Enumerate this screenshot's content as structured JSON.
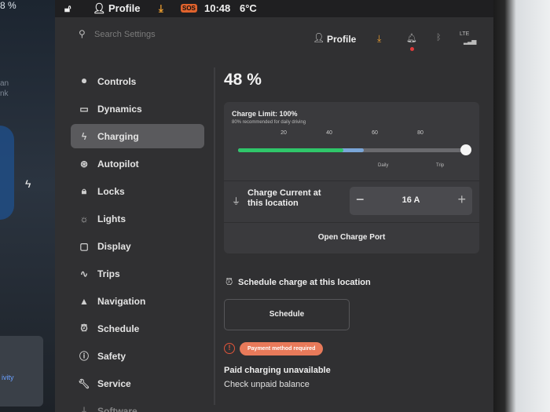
{
  "colors": {
    "accent_green": "#2fc66a",
    "accent_blue": "#7aa6d8",
    "warning": "#e87a5a",
    "download": "#f0a030"
  },
  "left_fragment": {
    "battery": "8 %",
    "lines": [
      "an",
      "nk"
    ],
    "card_text": "ivity"
  },
  "statusbar": {
    "profile": "Profile",
    "sos": "SOS",
    "time": "10:48",
    "temperature": "6°C"
  },
  "topbar": {
    "search_placeholder": "Search Settings",
    "profile": "Profile",
    "network": "LTE"
  },
  "sidebar": {
    "items": [
      {
        "label": "Controls",
        "icon": "toggle-icon"
      },
      {
        "label": "Dynamics",
        "icon": "car-icon"
      },
      {
        "label": "Charging",
        "icon": "bolt-icon",
        "active": true
      },
      {
        "label": "Autopilot",
        "icon": "steering-wheel-icon"
      },
      {
        "label": "Locks",
        "icon": "lock-icon"
      },
      {
        "label": "Lights",
        "icon": "sun-icon"
      },
      {
        "label": "Display",
        "icon": "display-icon"
      },
      {
        "label": "Trips",
        "icon": "trips-icon"
      },
      {
        "label": "Navigation",
        "icon": "navigation-arrow-icon"
      },
      {
        "label": "Schedule",
        "icon": "alarm-clock-icon"
      },
      {
        "label": "Safety",
        "icon": "info-circle-icon"
      },
      {
        "label": "Service",
        "icon": "wrench-icon"
      },
      {
        "label": "Software",
        "icon": "download-icon"
      }
    ]
  },
  "charging": {
    "battery_percent": "48 %",
    "charge_limit_label": "Charge Limit: 100%",
    "charge_limit_value": 100,
    "current_charge_value": 48,
    "recommendation": "80% recommended for daily driving",
    "scale_ticks": [
      "20",
      "40",
      "60",
      "80"
    ],
    "daily_label": "Daily",
    "trip_label": "Trip",
    "charge_current_label": "Charge Current at this location",
    "charge_current_value": "16 A",
    "stepper_minus": "−",
    "stepper_plus": "+",
    "open_charge_port": "Open Charge Port",
    "schedule_title": "Schedule charge at this location",
    "schedule_button": "Schedule",
    "payment_badge": "Payment method required",
    "paid_title": "Paid charging unavailable",
    "unpaid_link": "Check unpaid balance"
  }
}
